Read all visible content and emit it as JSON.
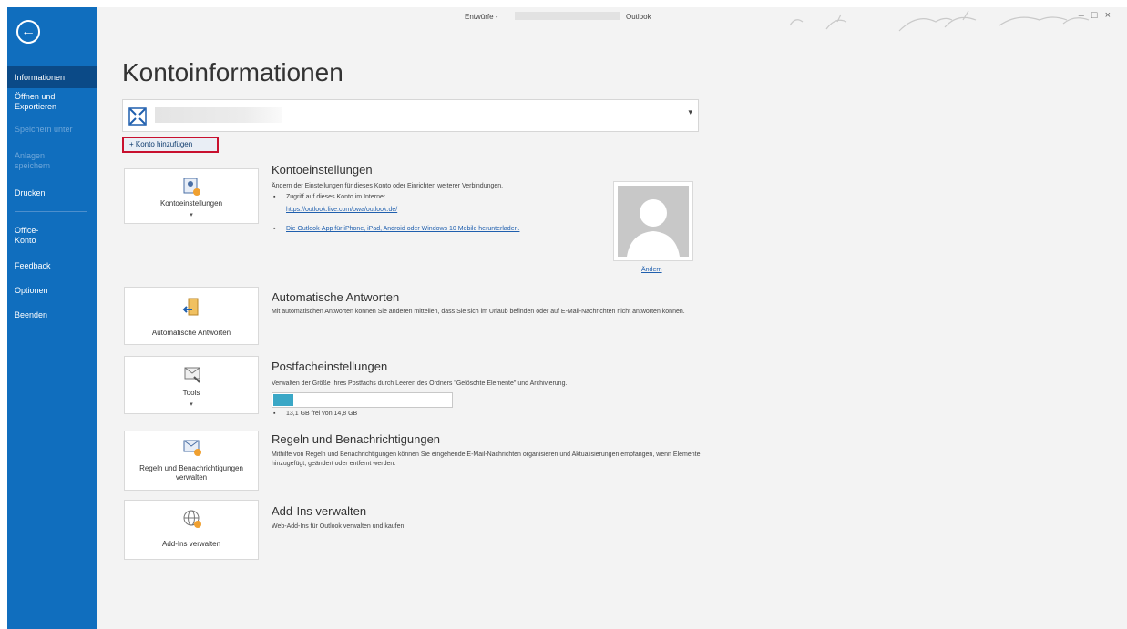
{
  "window": {
    "title_prefix": "Entwürfe -",
    "app_name": "Outlook"
  },
  "nav": {
    "items": [
      {
        "label": "Informationen"
      },
      {
        "label": "Öffnen und Exportieren"
      },
      {
        "label": "Speichern unter"
      },
      {
        "label": "Anlagen speichern"
      },
      {
        "label": "Drucken"
      },
      {
        "label": "Office-Konto"
      },
      {
        "label": "Feedback"
      },
      {
        "label": "Optionen"
      },
      {
        "label": "Beenden"
      }
    ]
  },
  "page": {
    "title": "Kontoinformationen"
  },
  "account": {
    "add_account_label": "+ Konto hinzufügen"
  },
  "sections": {
    "settings": {
      "tile_label": "Kontoeinstellungen",
      "title": "Kontoeinstellungen",
      "description": "Ändern der Einstellungen für dieses Konto oder Einrichten weiterer Verbindungen.",
      "bullet1": "Zugriff auf dieses Konto im Internet.",
      "link1": "https://outlook.live.com/owa/outlook.de/",
      "link2": "Die Outlook-App für iPhone, iPad, Android oder Windows 10 Mobile herunterladen.",
      "change_link": "Ändern"
    },
    "auto_reply": {
      "tile_label": "Automatische Antworten",
      "title": "Automatische Antworten",
      "description": "Mit automatischen Antworten können Sie anderen mitteilen, dass Sie sich im Urlaub befinden oder auf E-Mail-Nachrichten nicht antworten können."
    },
    "mailbox": {
      "tile_label": "Tools",
      "title": "Postfacheinstellungen",
      "description": "Verwalten der Größe Ihres Postfachs durch Leeren des Ordners \"Gelöschte Elemente\" und Archivierung.",
      "storage_text": "13,1 GB frei von 14,8 GB",
      "used_fraction": 0.115
    },
    "rules": {
      "tile_label": "Regeln und Benachrichtigungen verwalten",
      "title": "Regeln und Benachrichtigungen",
      "description": "Mithilfe von Regeln und Benachrichtigungen können Sie eingehende E-Mail-Nachrichten organisieren und Aktualisierungen empfangen, wenn Elemente hinzugefügt, geändert oder entfernt werden."
    },
    "addins": {
      "tile_label": "Add-Ins verwalten",
      "title": "Add-Ins verwalten",
      "description": "Web-Add-Ins für Outlook verwalten und kaufen."
    }
  },
  "colors": {
    "nav_bg": "#106ebe",
    "nav_active": "#0b4a87",
    "highlight_border": "#c8102e",
    "progress_fill": "#3aa7c6"
  }
}
